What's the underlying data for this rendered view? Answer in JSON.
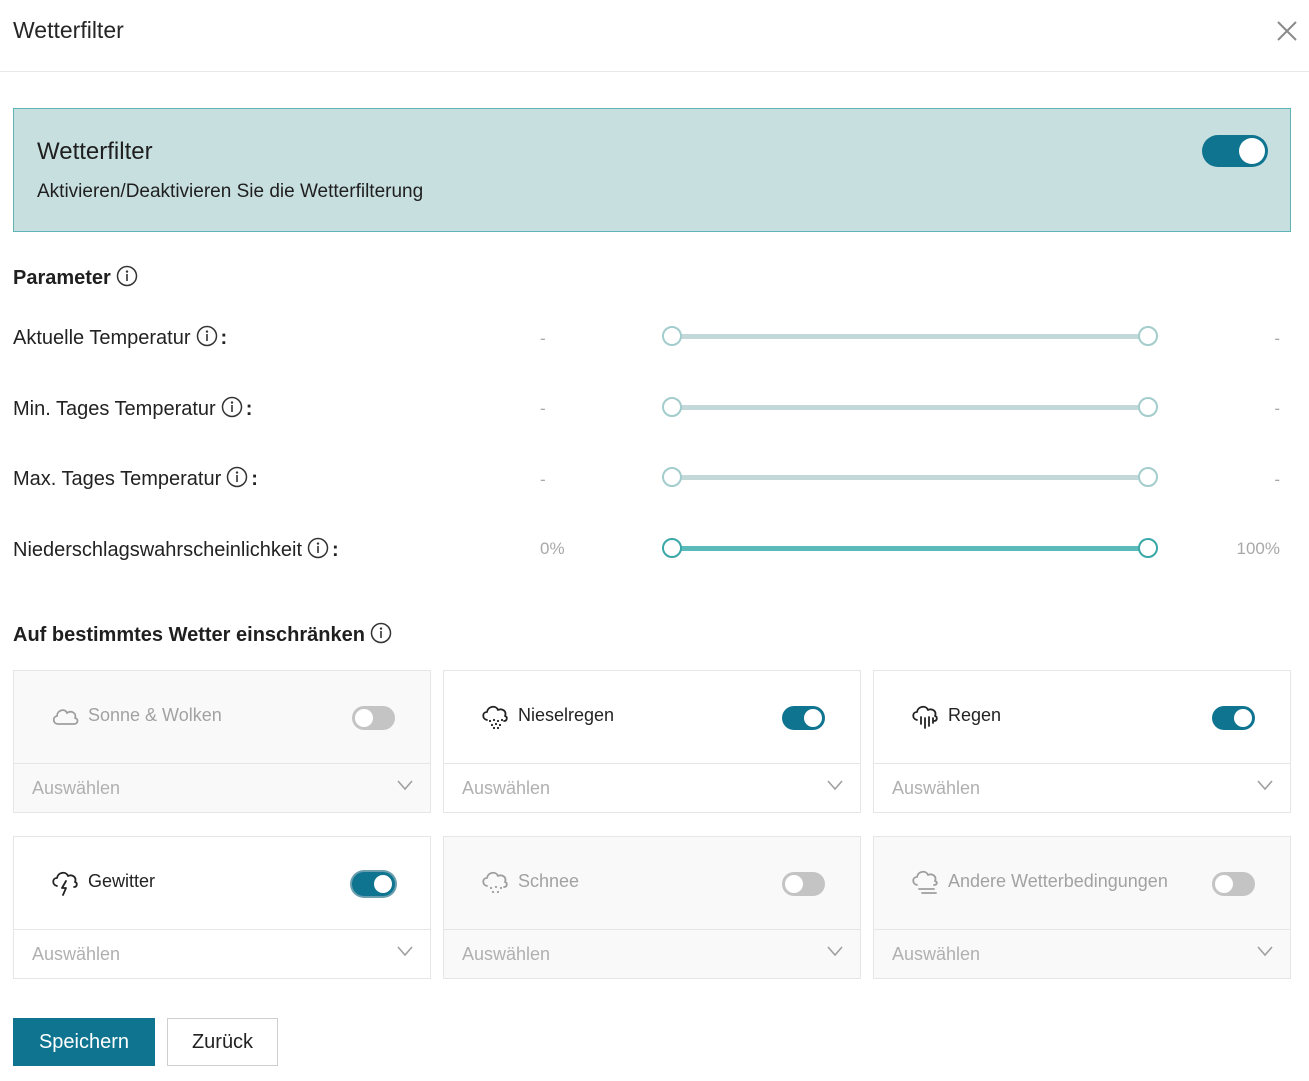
{
  "dialog": {
    "title": "Wetterfilter",
    "close_icon": "close-icon"
  },
  "banner": {
    "title": "Wetterfilter",
    "subtitle": "Aktivieren/Deaktivieren Sie die Wetterfilterung",
    "enabled": true
  },
  "parameters": {
    "heading": "Parameter",
    "rows": [
      {
        "label": "Aktuelle Temperatur",
        "suffix": ":",
        "min_label": "-",
        "max_label": "-",
        "range": [
          0,
          1
        ],
        "active": false
      },
      {
        "label": "Min. Tages Temperatur",
        "suffix": ":",
        "min_label": "-",
        "max_label": "-",
        "range": [
          0,
          1
        ],
        "active": false
      },
      {
        "label": "Max. Tages Temperatur",
        "suffix": ":",
        "min_label": "-",
        "max_label": "-",
        "range": [
          0,
          1
        ],
        "active": false
      },
      {
        "label": "Niederschlagswahrscheinlichkeit",
        "suffix": ":",
        "min_label": "0%",
        "max_label": "100%",
        "range": [
          0,
          1
        ],
        "active": true
      }
    ]
  },
  "weather": {
    "heading": "Auf bestimmtes Wetter einschränken",
    "cards": [
      {
        "name": "Sonne & Wolken",
        "icon": "cloud-icon",
        "enabled": false,
        "placeholder": "Auswählen"
      },
      {
        "name": "Nieselregen",
        "icon": "drizzle-icon",
        "enabled": true,
        "placeholder": "Auswählen"
      },
      {
        "name": "Regen",
        "icon": "rain-icon",
        "enabled": true,
        "placeholder": "Auswählen"
      },
      {
        "name": "Gewitter",
        "icon": "thunderstorm-icon",
        "enabled": true,
        "placeholder": "Auswählen"
      },
      {
        "name": "Schnee",
        "icon": "snow-icon",
        "enabled": false,
        "placeholder": "Auswählen"
      },
      {
        "name": "Andere Wetterbedingungen",
        "icon": "fog-icon",
        "enabled": false,
        "placeholder": "Auswählen"
      }
    ]
  },
  "footer": {
    "save_label": "Speichern",
    "back_label": "Zurück"
  },
  "colors": {
    "accent": "#0e7490",
    "banner_bg": "#c8dfe0",
    "slider_active": "#5bbaba"
  }
}
